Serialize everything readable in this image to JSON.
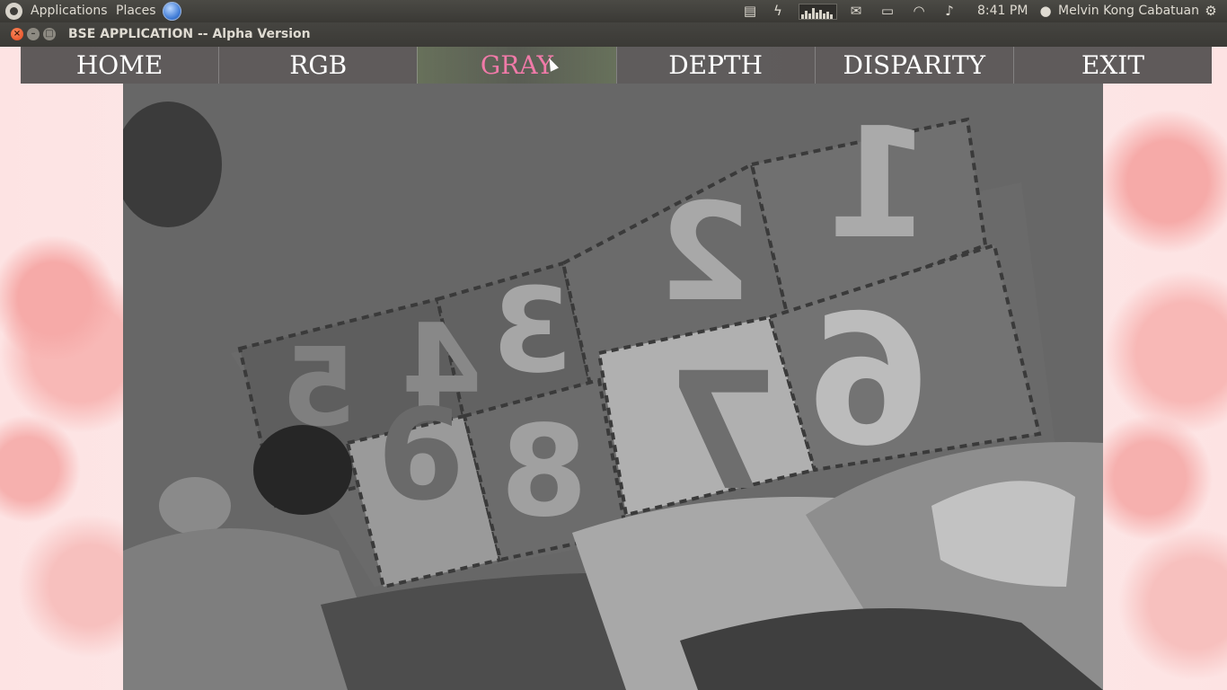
{
  "top_panel": {
    "applications_label": "Applications",
    "places_label": "Places",
    "clock": "8:41 PM",
    "user_name": "Melvin Kong Cabatuan",
    "icons": [
      "ubuntu-logo-icon",
      "globe-icon",
      "document-icon",
      "power-icon",
      "system-monitor-icon",
      "mail-icon",
      "battery-icon",
      "wifi-icon",
      "volume-icon",
      "user-icon",
      "gear-icon"
    ]
  },
  "window": {
    "title": "BSE APPLICATION -- Alpha Version",
    "close_glyph": "×",
    "minimize_glyph": "–",
    "maximize_glyph": "□"
  },
  "nav": {
    "items": [
      {
        "label": "HOME"
      },
      {
        "label": "RGB"
      },
      {
        "label": "GRAY"
      },
      {
        "label": "DEPTH"
      },
      {
        "label": "DISPARITY"
      },
      {
        "label": "EXIT"
      }
    ],
    "active_index": 2,
    "active_color": "#f07aa8"
  },
  "camera": {
    "mode": "grayscale",
    "puzzle_digits": [
      "5",
      "4",
      "3",
      "2",
      "1",
      "6",
      "7",
      "8",
      "9"
    ]
  }
}
